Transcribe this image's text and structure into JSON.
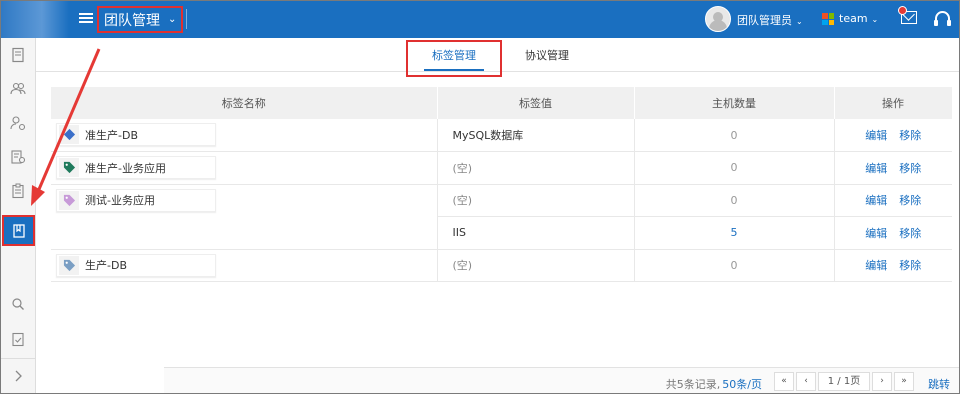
{
  "header": {
    "title": "团队管理",
    "user": "团队管理员",
    "team": "team",
    "brand_color": "#1a6fc0"
  },
  "sidebar": {
    "items": [
      {
        "icon": "document-icon"
      },
      {
        "icon": "users-icon"
      },
      {
        "icon": "user-settings-icon"
      },
      {
        "icon": "list-settings-icon"
      },
      {
        "icon": "clipboard-icon"
      },
      {
        "icon": "tag-book-icon",
        "active": true
      },
      {
        "icon": "search-icon"
      },
      {
        "icon": "checklist-icon"
      },
      {
        "icon": "chevron-right-icon"
      }
    ]
  },
  "tabs": [
    {
      "label": "标签管理",
      "active": true
    },
    {
      "label": "协议管理",
      "active": false
    }
  ],
  "table": {
    "columns": [
      "标签名称",
      "标签值",
      "主机数量",
      "操作"
    ],
    "rows": [
      {
        "tag": "准生产-DB",
        "tag_color": "#3b6fc9",
        "value": "MySQL数据库",
        "count": "0"
      },
      {
        "tag": "准生产-业务应用",
        "tag_color": "#1f7a5c",
        "value": "(空)",
        "count": "0"
      },
      {
        "tag": "测试-业务应用",
        "tag_color": "#c79ad8",
        "value": "(空)",
        "count": "0"
      },
      {
        "tag": "",
        "value": "IIS",
        "count": "5"
      },
      {
        "tag": "生产-DB",
        "tag_color": "#7b9fc4",
        "value": "(空)",
        "count": "0"
      }
    ],
    "edit_label": "编辑",
    "remove_label": "移除"
  },
  "pagination": {
    "summary": "共5条记录,",
    "page_size": "50条/页",
    "first": "«",
    "prev": "‹",
    "page_info": "1 / 1页",
    "next": "›",
    "last": "»",
    "jump": "跳转"
  }
}
